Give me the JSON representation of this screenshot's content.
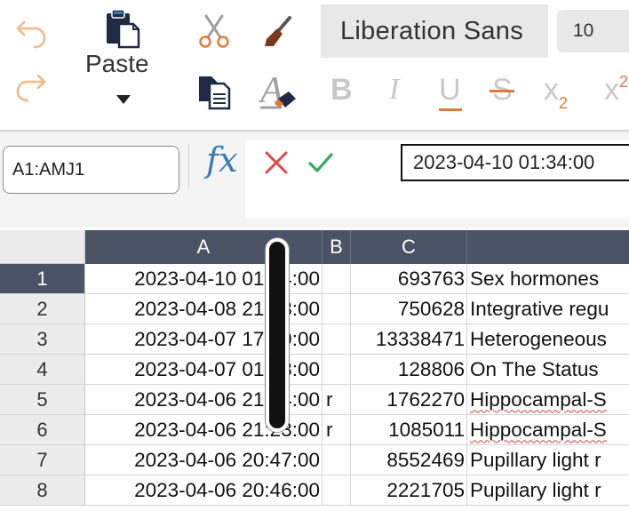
{
  "toolbar": {
    "paste_label": "Paste",
    "font_name": "Liberation Sans",
    "font_size": "10",
    "icons": [
      "undo-icon",
      "redo-icon",
      "paste-icon",
      "cut-icon",
      "copy-icon",
      "clone-formatting-icon",
      "clear-formatting-icon",
      "bold-icon",
      "italic-icon",
      "underline-icon",
      "strikethrough-icon",
      "subscript-icon",
      "superscript-icon"
    ],
    "bold_label": "B",
    "italic_label": "I",
    "underline_label": "U",
    "strike_label": "S",
    "subscript_label": "x",
    "subscript_mark": "2",
    "superscript_label": "x",
    "superscript_mark": "2"
  },
  "formula_bar": {
    "name_box": "A1:AMJ1",
    "fx_label": "fx",
    "content": "2023-04-10 01:34:00"
  },
  "grid": {
    "columns": [
      "A",
      "B",
      "C",
      ""
    ],
    "rows": [
      {
        "num": "1",
        "a": "2023-04-10 01:34:00",
        "b": "",
        "c": "693763",
        "d": "Sex hormones",
        "spell": false
      },
      {
        "num": "2",
        "a": "2023-04-08 21:58:00",
        "b": "",
        "c": "750628",
        "d": "Integrative regu",
        "spell": false
      },
      {
        "num": "3",
        "a": "2023-04-07 17:19:00",
        "b": "",
        "c": "13338471",
        "d": "Heterogeneous",
        "spell": false
      },
      {
        "num": "4",
        "a": "2023-04-07 01:48:00",
        "b": "",
        "c": "128806",
        "d": "On The Status",
        "spell": false
      },
      {
        "num": "5",
        "a": "2023-04-06 21:24:00",
        "b": "r",
        "c": "1762270",
        "d": "Hippocampal-S",
        "spell": true
      },
      {
        "num": "6",
        "a": "2023-04-06 21:23:00",
        "b": "r",
        "c": "1085011",
        "d": "Hippocampal-S",
        "spell": true
      },
      {
        "num": "7",
        "a": "2023-04-06 20:47:00",
        "b": "",
        "c": "8552469",
        "d": "Pupillary light r",
        "spell": false
      },
      {
        "num": "8",
        "a": "2023-04-06 20:46:00",
        "b": "",
        "c": "2221705",
        "d": "Pupillary light r",
        "spell": false
      }
    ],
    "selected_row": "1"
  },
  "colors": {
    "header_bg": "#4b5366",
    "accent_orange": "#e07a3a",
    "fx_blue": "#3a7ab8",
    "cancel_red": "#e04848",
    "accept_green": "#3aa85a"
  }
}
